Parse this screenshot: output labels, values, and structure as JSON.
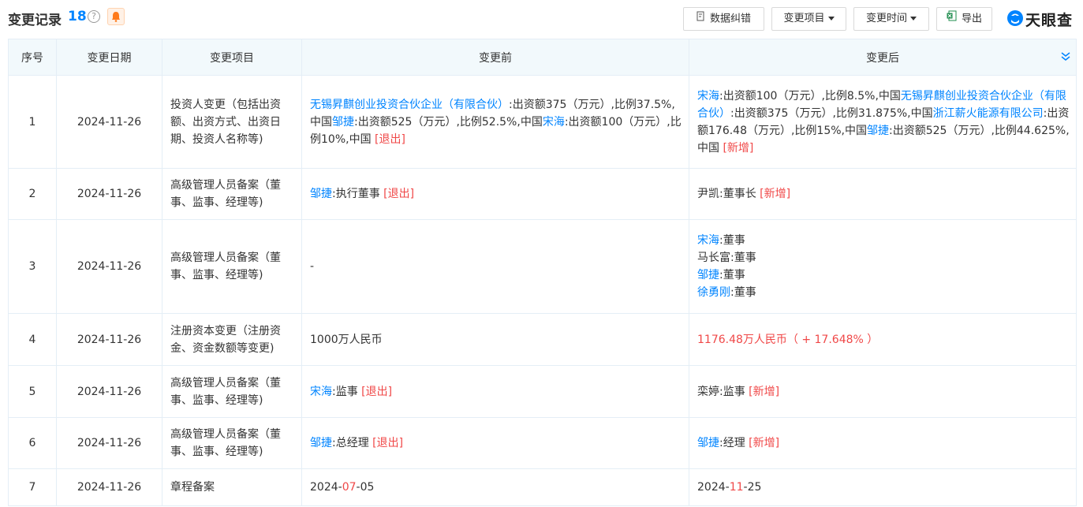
{
  "header": {
    "title": "变更记录",
    "count": "18",
    "help": "?",
    "buttons": {
      "correct": "数据纠错",
      "item_filter": "变更项目",
      "time_filter": "变更时间",
      "export": "导出"
    },
    "logo_text": "天眼查"
  },
  "table": {
    "columns": [
      "序号",
      "变更日期",
      "变更项目",
      "变更前",
      "变更后"
    ],
    "rows": [
      {
        "index": "1",
        "date": "2024-11-26",
        "item": "投资人变更（包括出资额、出资方式、出资日期、投资人名称等)",
        "before": {
          "link1": "无锡昇麒创业投资合伙企业（有限合伙）",
          "text1": ":出资额375（万元）,比例37.5%,中国",
          "link2": "邹捷",
          "text2": ":出资额525（万元）,比例52.5%,中国",
          "link3": "宋海",
          "text3": ":出资额100（万元）,比例10%,中国",
          "tag": "[退出]"
        },
        "after": {
          "link1": "宋海",
          "text1": ":出资额100（万元）,比例8.5%,中国",
          "link2": "无锡昇麒创业投资合伙企业（有限合伙）",
          "text2": ":出资额375（万元）,比例31.875%,中国",
          "link3": "浙江薪火能源有限公司",
          "text3": ":出资额176.48（万元）,比例15%,中国",
          "link4": "邹捷",
          "text4": ":出资额525（万元）,比例44.625%,中国",
          "tag": "[新增]"
        }
      },
      {
        "index": "2",
        "date": "2024-11-26",
        "item": "高级管理人员备案（董事、监事、经理等)",
        "before": {
          "link": "邹捷",
          "text": ":执行董事",
          "tag": "[退出]"
        },
        "after": {
          "text": "尹凯:董事长",
          "tag": "[新增]"
        }
      },
      {
        "index": "3",
        "date": "2024-11-26",
        "item": "高级管理人员备案（董事、监事、经理等)",
        "before": {
          "text": "-"
        },
        "after": {
          "l1_link": "宋海",
          "l1_text": ":董事",
          "l2_text": "马长富:董事",
          "l3_link": "邹捷",
          "l3_text": ":董事",
          "l4_link": "徐勇刚",
          "l4_text": ":董事"
        }
      },
      {
        "index": "4",
        "date": "2024-11-26",
        "item": "注册资本变更（注册资金、资金数额等变更)",
        "before": {
          "text": "1000万人民币"
        },
        "after": {
          "text": "1176.48万人民币（ + 17.648% ）"
        }
      },
      {
        "index": "5",
        "date": "2024-11-26",
        "item": "高级管理人员备案（董事、监事、经理等)",
        "before": {
          "link": "宋海",
          "text": ":监事",
          "tag": "[退出]"
        },
        "after": {
          "text": "栾婷:监事",
          "tag": "[新增]"
        }
      },
      {
        "index": "6",
        "date": "2024-11-26",
        "item": "高级管理人员备案（董事、监事、经理等)",
        "before": {
          "link": "邹捷",
          "text": ":总经理",
          "tag": "[退出]"
        },
        "after": {
          "link": "邹捷",
          "text": ":经理",
          "tag": "[新增]"
        }
      },
      {
        "index": "7",
        "date": "2024-11-26",
        "item": "章程备案",
        "before": {
          "p1": "2024-",
          "p2": "07",
          "p3": "-05"
        },
        "after": {
          "p1": "2024-",
          "p2": "11",
          "p3": "-25"
        }
      }
    ]
  },
  "colors": {
    "link": "#0084ff",
    "tag": "#f04848",
    "header_bg": "#f2f9fc"
  }
}
